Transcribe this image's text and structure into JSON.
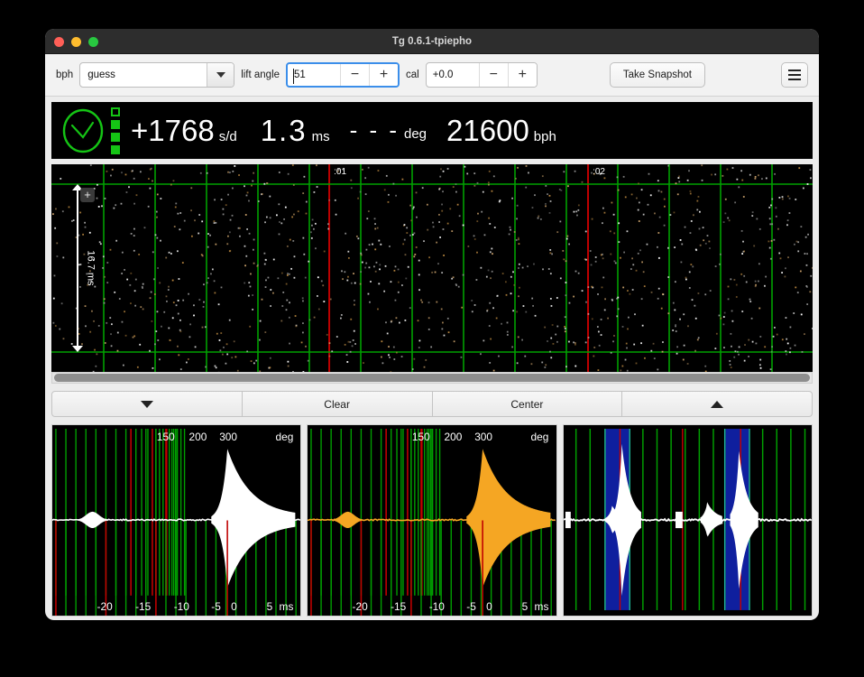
{
  "window": {
    "title": "Tg 0.6.1-tpiepho",
    "traffic_lights": [
      "close-red",
      "minimize-yellow",
      "zoom-green"
    ]
  },
  "toolbar": {
    "bph_label": "bph",
    "bph_value": "guess",
    "lift_angle_label": "lift angle",
    "lift_angle_value": "51",
    "cal_label": "cal",
    "cal_value": "+0.0",
    "minus": "−",
    "plus": "+",
    "snapshot_label": "Take Snapshot",
    "menu_icon": "hamburger-icon"
  },
  "readout": {
    "status_icon": "watch-ok-icon",
    "rate_value": "+1768",
    "rate_unit": "s/d",
    "beat_error_value": "1.3",
    "beat_error_unit": "ms",
    "amplitude_value": "- - -",
    "amplitude_unit": "deg",
    "bph_value": "21600",
    "bph_unit": "bph",
    "segments_total": 4,
    "segments_filled": 3
  },
  "paperstrip": {
    "scale_label": "16.7 ms",
    "zoom_badge": "+",
    "time_markers": [
      {
        "label": ":01",
        "x_pct": 36.5
      },
      {
        "label": ":02",
        "x_pct": 70.5
      }
    ]
  },
  "controls": {
    "down_label": "▼",
    "clear_label": "Clear",
    "center_label": "Center",
    "up_label": "▲"
  },
  "panels": [
    {
      "name": "tic-trace",
      "wave_color": "#ffffff",
      "baseline_color": "#ffffff",
      "deg_unit": "deg",
      "deg_ticks": [
        "150",
        "200",
        "300"
      ],
      "ms_unit": "ms",
      "ms_ticks": [
        "-20",
        "-15",
        "-10",
        "-5",
        "0",
        "5"
      ]
    },
    {
      "name": "toc-trace",
      "wave_color": "#f5a623",
      "baseline_color": "#f5a623",
      "deg_unit": "deg",
      "deg_ticks": [
        "150",
        "200",
        "300"
      ],
      "ms_unit": "ms",
      "ms_ticks": [
        "-20",
        "-15",
        "-10",
        "-5",
        "0",
        "5"
      ]
    },
    {
      "name": "period-trace",
      "wave_color": "#ffffff",
      "baseline_color": "#ffffff",
      "deg_unit": "",
      "deg_ticks": [],
      "ms_unit": "",
      "ms_ticks": []
    }
  ],
  "colors": {
    "grid_green": "#00a000",
    "grid_red": "#c00000",
    "band_blue": "#0f1f9e",
    "status_green": "#15c415",
    "screen_black": "#000000",
    "chrome_gray": "#ececec"
  }
}
